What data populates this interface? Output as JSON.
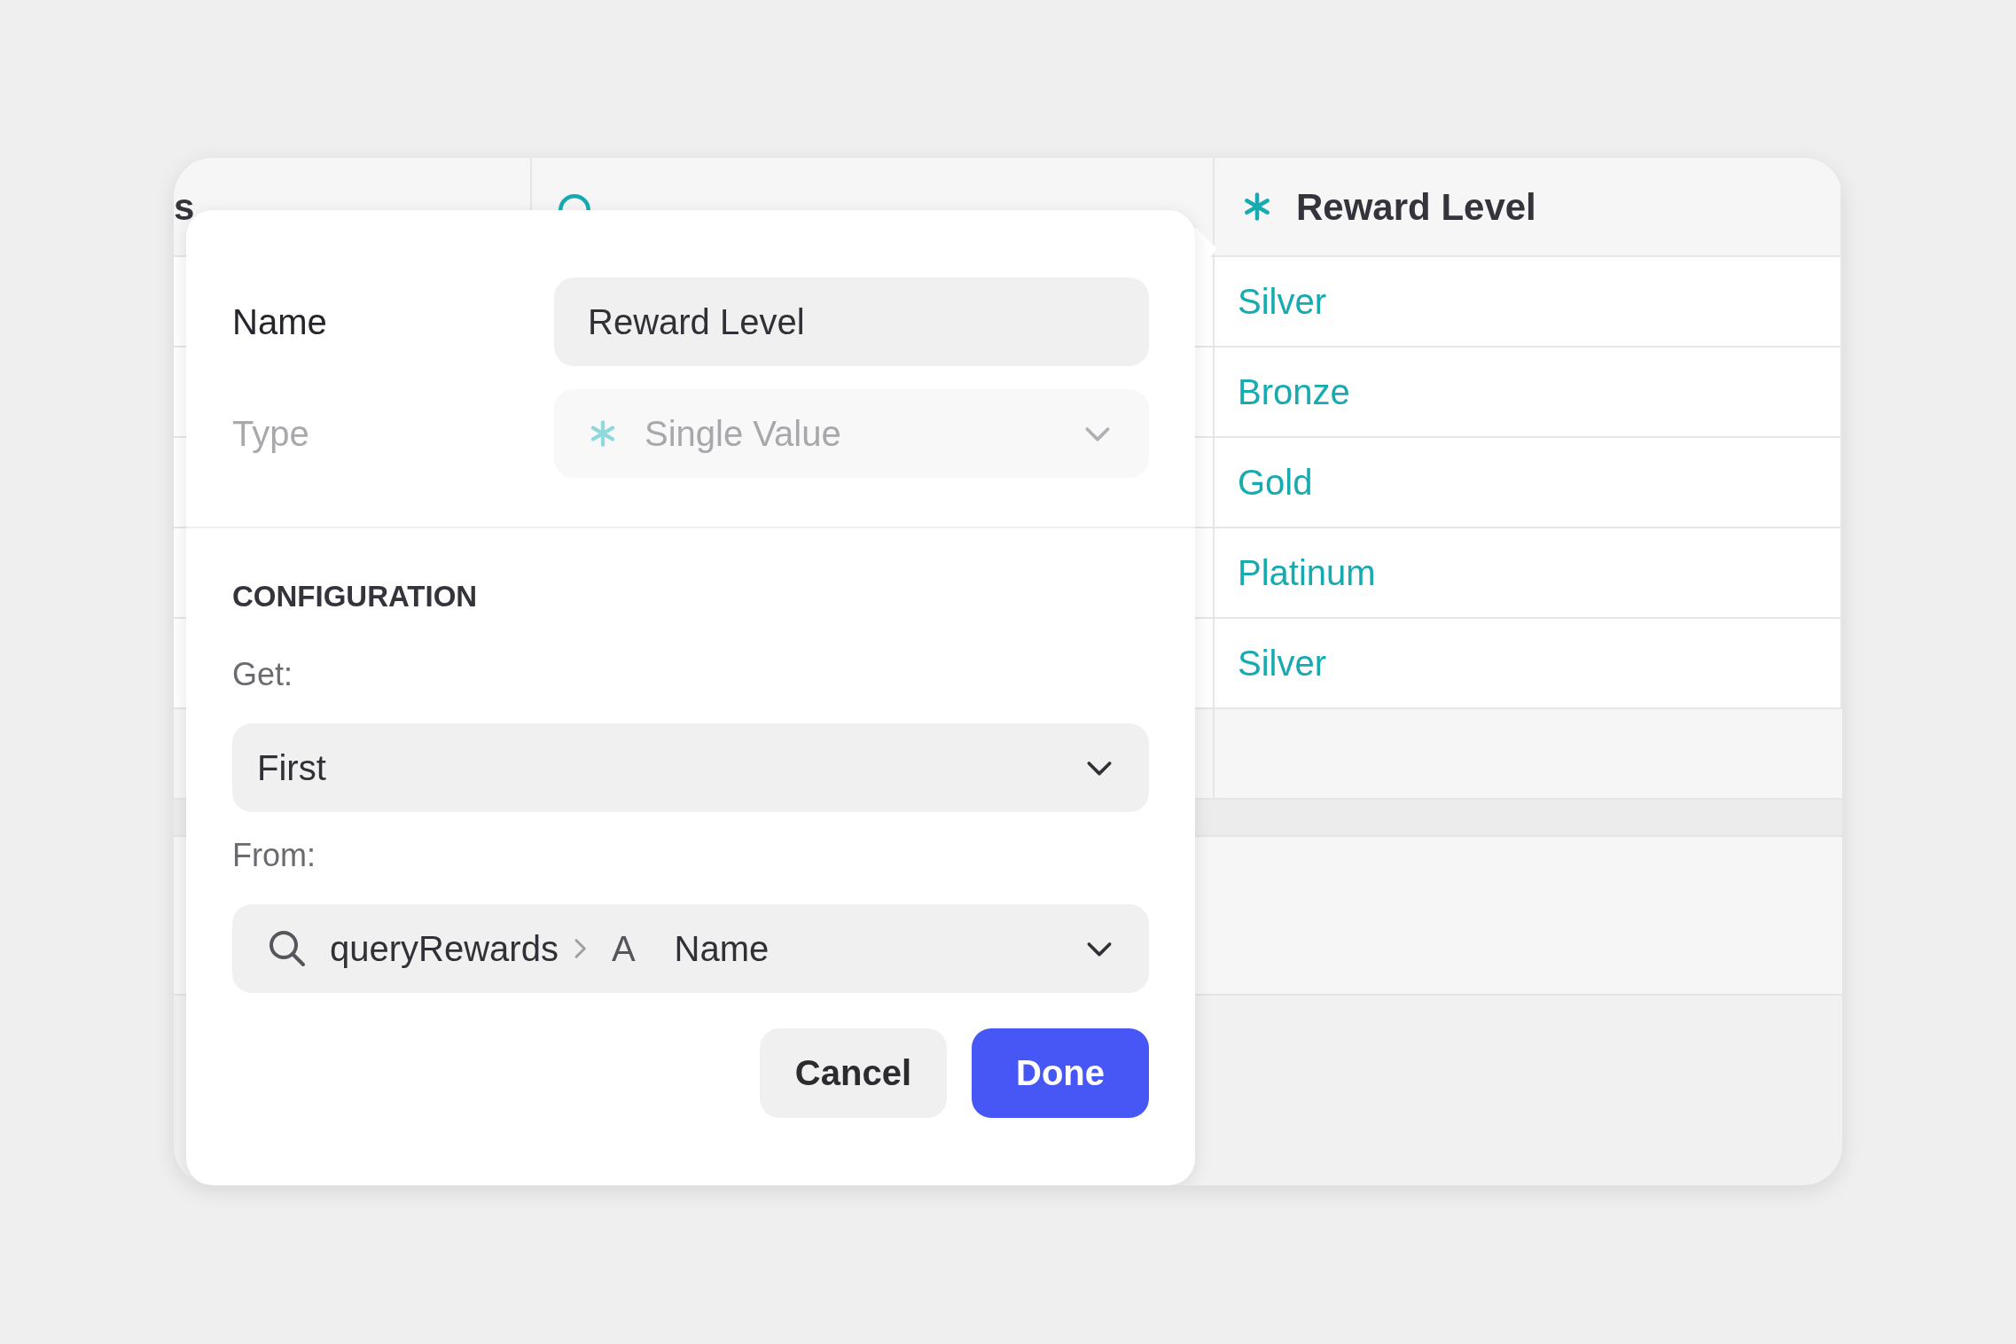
{
  "table": {
    "columns": [
      {
        "label": "s",
        "kind": "plain"
      },
      {
        "kind": "query"
      },
      {
        "label": "Reward Level",
        "kind": "value"
      }
    ],
    "rows": [
      "Silver",
      "Bronze",
      "Gold",
      "Platinum",
      "Silver"
    ]
  },
  "popover": {
    "name_label": "Name",
    "name_value": "Reward Level",
    "type_label": "Type",
    "type_value": "Single Value",
    "type_disabled": true,
    "section_title": "CONFIGURATION",
    "get_label": "Get:",
    "get_value": "First",
    "from_label": "From:",
    "from_source": "queryRewards",
    "from_glyph": "A",
    "from_field": "Name",
    "buttons": [
      {
        "label": "Cancel",
        "kind": "secondary"
      },
      {
        "label": "Done",
        "kind": "primary"
      }
    ]
  }
}
